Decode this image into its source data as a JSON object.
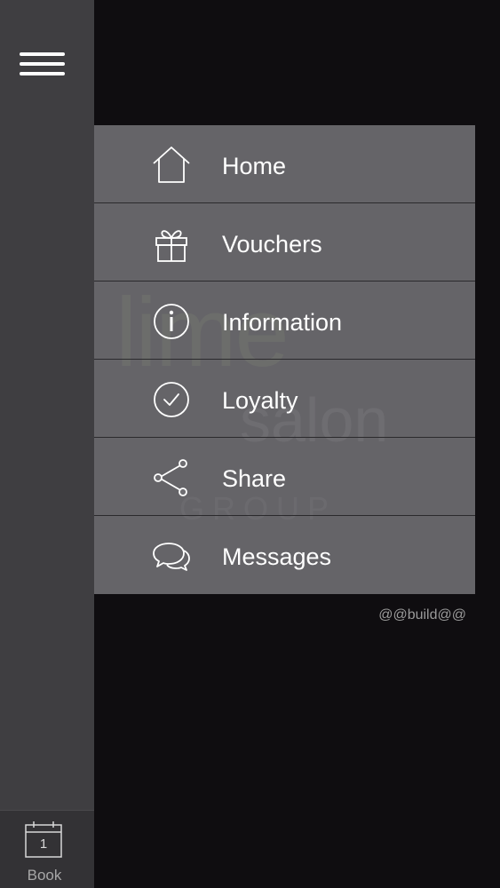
{
  "sidebar": {
    "book_tab": {
      "day": "1",
      "label": "Book"
    }
  },
  "logo": {
    "word1": "lime",
    "word2": "salon",
    "word3": "GROUP"
  },
  "menu": {
    "items": [
      {
        "label": "Home",
        "icon": "home-icon"
      },
      {
        "label": "Vouchers",
        "icon": "gift-icon"
      },
      {
        "label": "Information",
        "icon": "info-icon"
      },
      {
        "label": "Loyalty",
        "icon": "checkmark-circle-icon"
      },
      {
        "label": "Share",
        "icon": "share-icon"
      },
      {
        "label": "Messages",
        "icon": "chat-bubbles-icon"
      }
    ]
  },
  "build_tag": "@@build@@",
  "colors": {
    "background": "#0f0d10",
    "sidebar": "#3f3e41",
    "menu": "#767579",
    "logo_accent": "#8bb33c"
  }
}
